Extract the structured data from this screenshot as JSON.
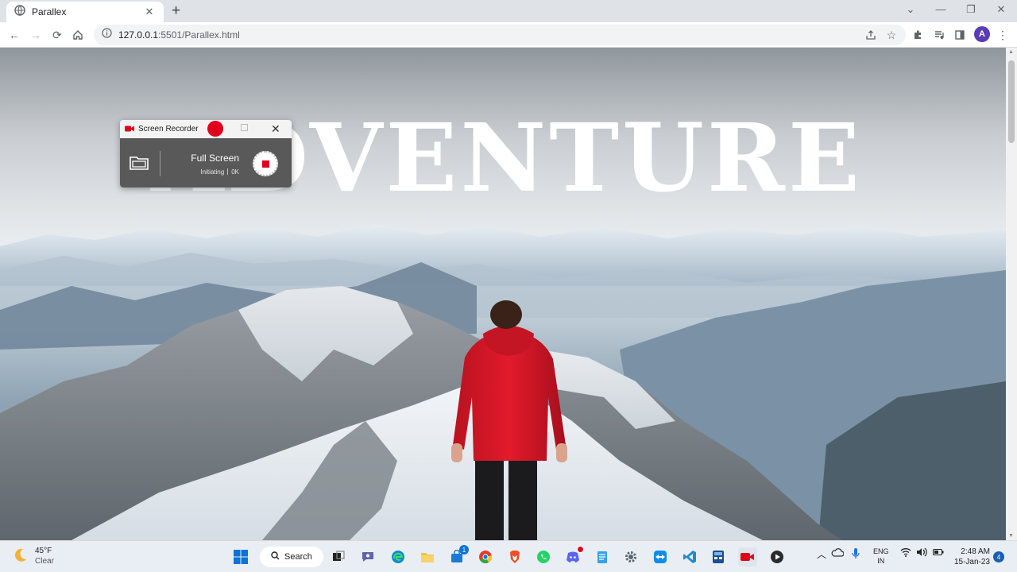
{
  "browser": {
    "tab_title": "Parallex",
    "tab_close": "✕",
    "new_tab": "+",
    "url_host": "127.0.0.1",
    "url_path": ":5501/Parallex.html",
    "profile_initial": "A"
  },
  "page": {
    "hero_word": "ADVENTURE"
  },
  "recorder": {
    "title": "Screen Recorder",
    "mode": "Full Screen",
    "status": "Initiating",
    "size": "0K",
    "close": "✕",
    "accent": "#e0001b"
  },
  "taskbar": {
    "temperature": "45°F",
    "condition": "Clear",
    "search_label": "Search",
    "store_badge": "1",
    "lang_top": "ENG",
    "lang_bottom": "IN",
    "time": "2:48 AM",
    "date": "15-Jan-23",
    "notifications": "4"
  }
}
